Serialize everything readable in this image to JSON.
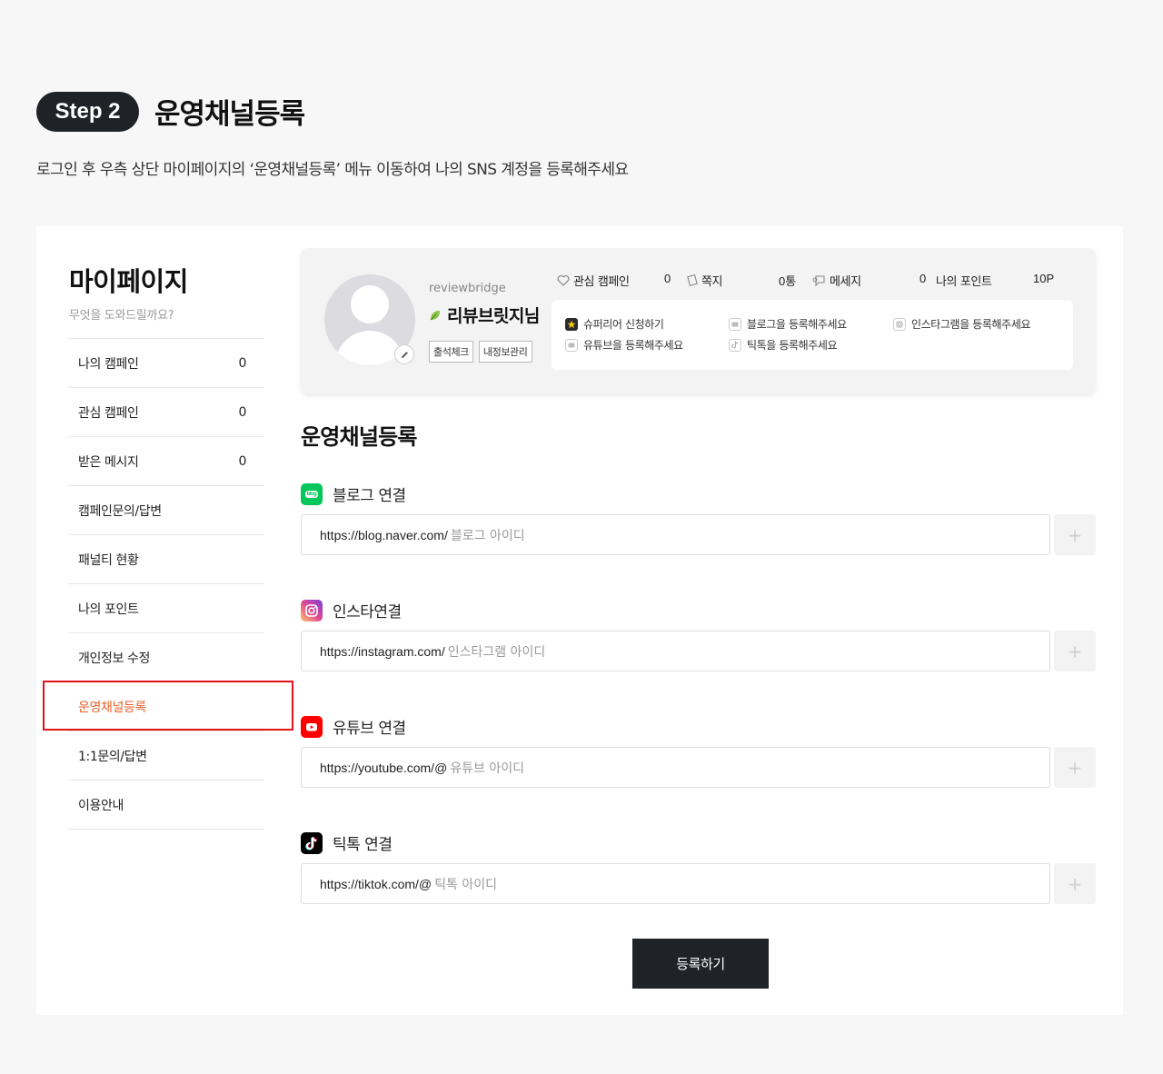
{
  "step": {
    "badge": "Step 2",
    "title": "운영채널등록",
    "description": "로그인 후 우측 상단 마이페이지의 ‘운영채널등록’ 메뉴 이동하여 나의 SNS 계정을 등록해주세요"
  },
  "sidebar": {
    "title": "마이페이지",
    "subtitle": "무엇을 도와드릴까요?",
    "items": [
      {
        "label": "나의 캠페인",
        "count": "0"
      },
      {
        "label": "관심 캠페인",
        "count": "0"
      },
      {
        "label": "받은 메시지",
        "count": "0"
      },
      {
        "label": "캠페인문의/답변",
        "count": ""
      },
      {
        "label": "패널티 현황",
        "count": ""
      },
      {
        "label": "나의 포인트",
        "count": ""
      },
      {
        "label": "개인정보 수정",
        "count": ""
      },
      {
        "label": "운영채널등록",
        "count": ""
      },
      {
        "label": "1:1문의/답변",
        "count": ""
      },
      {
        "label": "이용안내",
        "count": ""
      }
    ],
    "active_item": "운영채널등록",
    "active_color": "#e8612c"
  },
  "profile": {
    "user_id": "reviewbridge",
    "name": "리뷰브릿지님",
    "tags": [
      "출석체크",
      "내정보관리"
    ],
    "stats": {
      "fav_label": "관심 캠페인",
      "fav_value": "0",
      "note_label": "쪽지",
      "note_value": "0통",
      "msg_label": "메세지",
      "msg_value": "0",
      "point_label": "나의 포인트",
      "point_value": "10P"
    },
    "quick_links": [
      "슈퍼리어 신청하기",
      "유튜브을 등록해주세요",
      "블로그을 등록해주세요",
      "틱톡을 등록해주세요",
      "인스타그램을 등록해주세요"
    ]
  },
  "main": {
    "title": "운영채널등록",
    "channels": [
      {
        "label": "블로그 연결",
        "prefix": "https://blog.naver.com/",
        "placeholder": "블로그 아이디",
        "icon": "naver-blog-icon",
        "color": "#03c75a"
      },
      {
        "label": "인스타연결",
        "prefix": "https://instagram.com/",
        "placeholder": "인스타그램 아이디",
        "icon": "instagram-icon",
        "color": "#d6249f"
      },
      {
        "label": "유튜브 연결",
        "prefix": "https://youtube.com/@",
        "placeholder": "유튜브 아이디",
        "icon": "youtube-icon",
        "color": "#ff0000"
      },
      {
        "label": "틱톡 연결",
        "prefix": "https://tiktok.com/@",
        "placeholder": "틱톡 아이디",
        "icon": "tiktok-icon",
        "color": "#000000"
      }
    ],
    "add_symbol": "+",
    "submit_label": "등록하기"
  }
}
